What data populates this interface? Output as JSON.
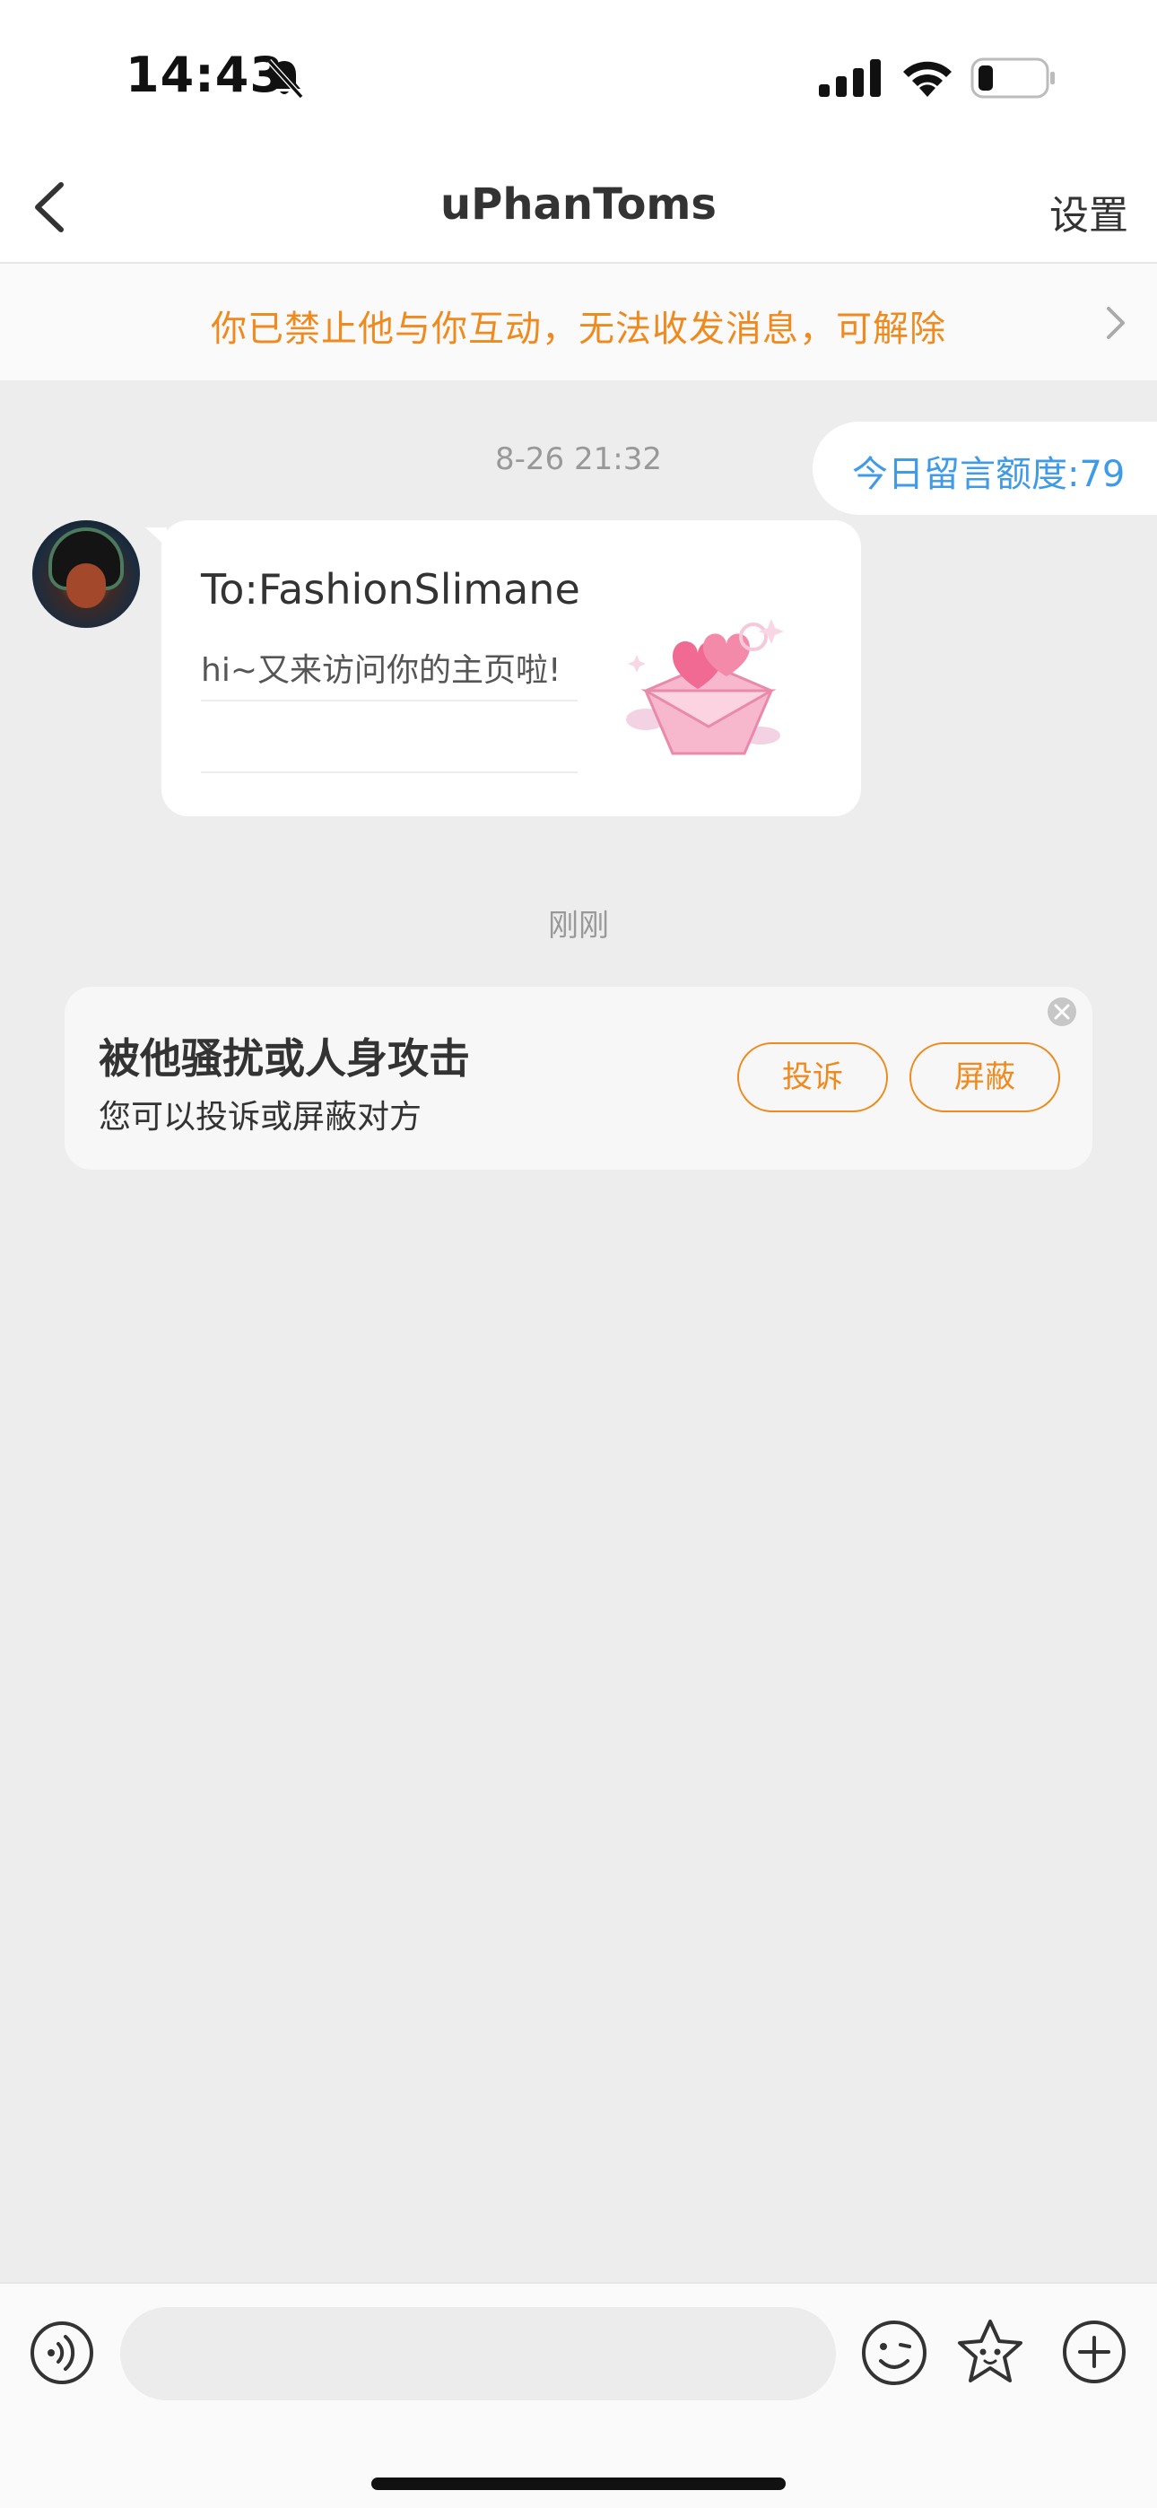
{
  "status_bar": {
    "time": "14:43",
    "icons": [
      "bell-muted-icon",
      "cellular-signal-icon",
      "wifi-icon",
      "battery-icon"
    ]
  },
  "nav": {
    "title": "uPhanToms",
    "settings_label": "设置"
  },
  "banner": {
    "text": "你已禁止他与你互动，无法收发消息，可解除"
  },
  "chat": {
    "timestamp_1": "8-26 21:32",
    "quota": "今日留言额度:79",
    "card": {
      "to": "To:FashionSlimane",
      "message": "hi~又来访问你的主页啦!"
    },
    "timestamp_2": "刚刚"
  },
  "report_card": {
    "title": "被他骚扰或人身攻击",
    "subtitle": "您可以投诉或屏蔽对方",
    "complain_label": "投诉",
    "block_label": "屏蔽"
  },
  "input_bar": {
    "placeholder": ""
  },
  "colors": {
    "accent_orange": "#ef8a1f",
    "link_blue": "#3f9be8",
    "background": "#ededed"
  }
}
